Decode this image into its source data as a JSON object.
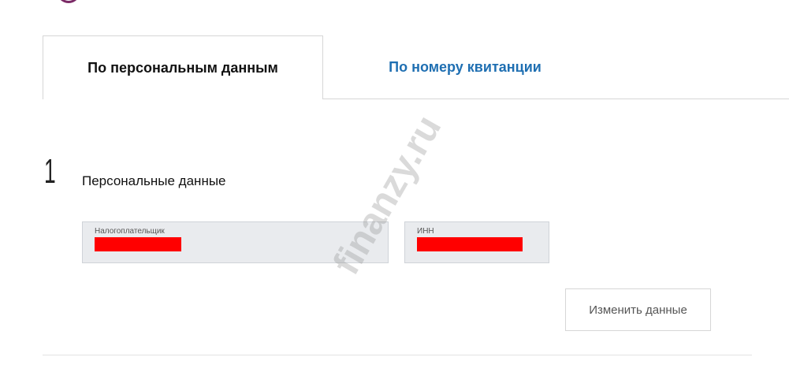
{
  "tabs": [
    {
      "label": "По персональным данным",
      "active": true
    },
    {
      "label": "По номеру квитанции",
      "active": false
    }
  ],
  "step": {
    "number": "1",
    "title": "Персональные данные"
  },
  "fields": {
    "taxpayer": {
      "label": "Налогоплательщик",
      "value_state": "redacted"
    },
    "inn": {
      "label": "ИНН",
      "value_state": "redacted"
    }
  },
  "change_button_label": "Изменить данные",
  "watermark": "finanzy.ru",
  "colors": {
    "tab_link": "#1f6fb2",
    "field_bg": "#e9ebee",
    "redaction": "#ff0000",
    "logo": "#7b2a66"
  }
}
